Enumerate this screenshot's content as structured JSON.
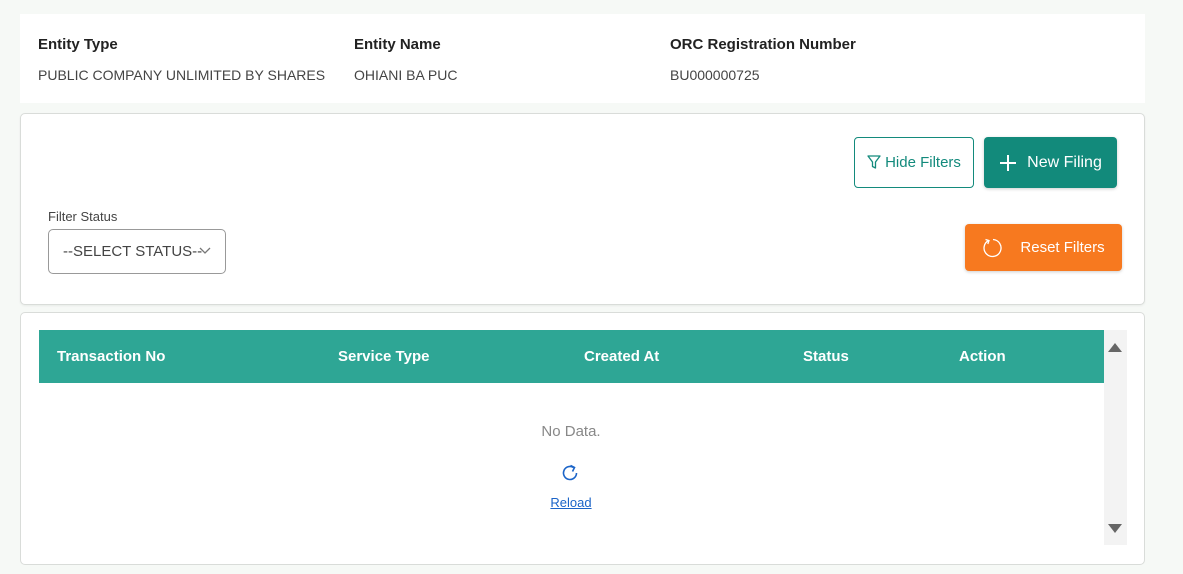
{
  "entity": {
    "type_label": "Entity Type",
    "type_value": "PUBLIC COMPANY UNLIMITED BY SHARES",
    "name_label": "Entity Name",
    "name_value": "OHIANI BA PUC",
    "orc_label": "ORC Registration Number",
    "orc_value": "BU000000725"
  },
  "filters": {
    "hide_label": "Hide Filters",
    "new_label": "New Filing",
    "status_label": "Filter Status",
    "status_selected": "--SELECT STATUS--",
    "reset_label": "Reset Filters"
  },
  "table": {
    "columns": [
      "Transaction No",
      "Service Type",
      "Created At",
      "Status",
      "Action"
    ],
    "empty_text": "No Data.",
    "reload_label": "Reload"
  },
  "colors": {
    "primary": "#128a7b",
    "header": "#2ea695",
    "reset": "#f7791f",
    "link": "#1b64c8"
  },
  "icons": [
    "filter-icon",
    "plus-icon",
    "chevron-down-icon",
    "refresh-icon",
    "reload-icon",
    "scroll-up-icon",
    "scroll-down-icon"
  ]
}
